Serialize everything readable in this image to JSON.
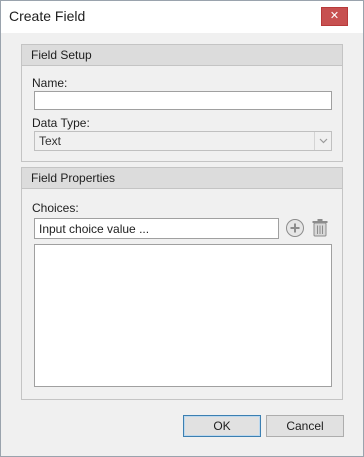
{
  "window": {
    "title": "Create Field",
    "close_symbol": "✕"
  },
  "field_setup": {
    "header": "Field Setup",
    "name_label": "Name:",
    "name_value": "",
    "data_type_label": "Data Type:",
    "data_type_value": "Text"
  },
  "field_properties": {
    "header": "Field Properties",
    "choices_label": "Choices:",
    "choice_input_value": "Input choice value ...",
    "choices": []
  },
  "buttons": {
    "ok": "OK",
    "cancel": "Cancel"
  },
  "icons": {
    "add": "add-circle-icon",
    "delete": "trash-icon",
    "dropdown": "chevron-down-icon",
    "close": "close-icon"
  }
}
